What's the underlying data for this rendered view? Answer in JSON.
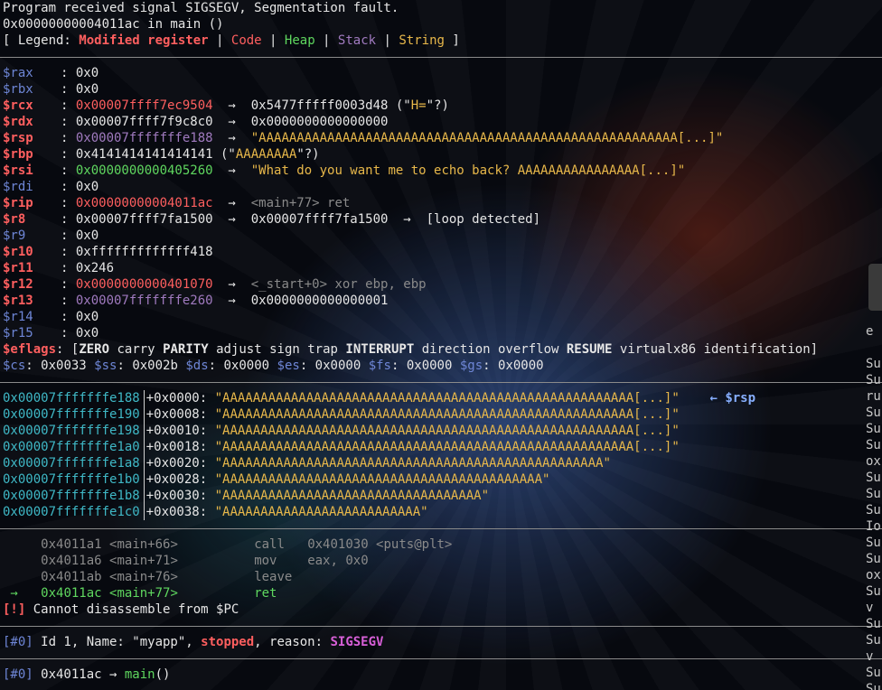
{
  "header": {
    "signal": "Program received signal SIGSEGV, Segmentation fault.",
    "location": "0x00000000004011ac in main ()",
    "legend_open": "[ Legend: ",
    "legend_modified": "Modified register",
    "legend_code": "Code",
    "legend_heap": "Heap",
    "legend_stack": "Stack",
    "legend_string": "String",
    "legend_sep": " | ",
    "legend_close": " ]"
  },
  "registers": [
    {
      "name": "$rax",
      "modified": false,
      "parts": [
        {
          "t": "0x0",
          "c": ""
        }
      ]
    },
    {
      "name": "$rbx",
      "modified": false,
      "parts": [
        {
          "t": "0x0",
          "c": ""
        }
      ]
    },
    {
      "name": "$rcx",
      "modified": true,
      "parts": [
        {
          "t": "0x00007ffff7ec9504",
          "c": "red"
        },
        {
          "t": "  →  0x5477fffff0003d48 (\"",
          "c": ""
        },
        {
          "t": "H=",
          "c": "yellow"
        },
        {
          "t": "\"?)",
          "c": ""
        }
      ]
    },
    {
      "name": "$rdx",
      "modified": true,
      "parts": [
        {
          "t": "0x00007ffff7f9c8c0  →  0x0000000000000000",
          "c": ""
        }
      ]
    },
    {
      "name": "$rsp",
      "modified": true,
      "parts": [
        {
          "t": "0x00007fffffffe188",
          "c": "purple"
        },
        {
          "t": "  →  ",
          "c": ""
        },
        {
          "t": "\"AAAAAAAAAAAAAAAAAAAAAAAAAAAAAAAAAAAAAAAAAAAAAAAAAAAAAAA[...]\"",
          "c": "yellow"
        }
      ]
    },
    {
      "name": "$rbp",
      "modified": true,
      "parts": [
        {
          "t": "0x4141414141414141 (\"",
          "c": ""
        },
        {
          "t": "AAAAAAAA",
          "c": "yellow"
        },
        {
          "t": "\"?)",
          "c": ""
        }
      ]
    },
    {
      "name": "$rsi",
      "modified": true,
      "parts": [
        {
          "t": "0x0000000000405260",
          "c": "green"
        },
        {
          "t": "  →  ",
          "c": ""
        },
        {
          "t": "\"What do you want me to echo back? AAAAAAAAAAAAAAAA[...]\"",
          "c": "yellow"
        }
      ]
    },
    {
      "name": "$rdi",
      "modified": false,
      "parts": [
        {
          "t": "0x0",
          "c": ""
        }
      ]
    },
    {
      "name": "$rip",
      "modified": true,
      "parts": [
        {
          "t": "0x00000000004011ac",
          "c": "red"
        },
        {
          "t": "  →  ",
          "c": ""
        },
        {
          "t": "<main+77> ret",
          "c": "gray"
        }
      ]
    },
    {
      "name": "$r8",
      "modified": true,
      "parts": [
        {
          "t": "0x00007ffff7fa1500  →  0x00007ffff7fa1500  →  [loop detected]",
          "c": ""
        }
      ]
    },
    {
      "name": "$r9",
      "modified": false,
      "parts": [
        {
          "t": "0x0",
          "c": ""
        }
      ]
    },
    {
      "name": "$r10",
      "modified": true,
      "parts": [
        {
          "t": "0xfffffffffffff418",
          "c": ""
        }
      ]
    },
    {
      "name": "$r11",
      "modified": true,
      "parts": [
        {
          "t": "0x246",
          "c": ""
        }
      ]
    },
    {
      "name": "$r12",
      "modified": true,
      "parts": [
        {
          "t": "0x0000000000401070",
          "c": "red"
        },
        {
          "t": "  →  ",
          "c": ""
        },
        {
          "t": "<_start+0> xor ebp, ebp",
          "c": "gray"
        }
      ]
    },
    {
      "name": "$r13",
      "modified": true,
      "parts": [
        {
          "t": "0x00007fffffffe260",
          "c": "purple"
        },
        {
          "t": "  →  0x0000000000000001",
          "c": ""
        }
      ]
    },
    {
      "name": "$r14",
      "modified": false,
      "parts": [
        {
          "t": "0x0",
          "c": ""
        }
      ]
    },
    {
      "name": "$r15",
      "modified": false,
      "parts": [
        {
          "t": "0x0",
          "c": ""
        }
      ]
    }
  ],
  "eflags": {
    "label": "$eflags",
    "open": "[",
    "flags": [
      {
        "t": "ZERO",
        "b": true
      },
      {
        "t": "carry",
        "b": false
      },
      {
        "t": "PARITY",
        "b": true
      },
      {
        "t": "adjust",
        "b": false
      },
      {
        "t": "sign",
        "b": false
      },
      {
        "t": "trap",
        "b": false
      },
      {
        "t": "INTERRUPT",
        "b": true
      },
      {
        "t": "direction",
        "b": false
      },
      {
        "t": "overflow",
        "b": false
      },
      {
        "t": "RESUME",
        "b": true
      },
      {
        "t": "virtualx86",
        "b": false
      },
      {
        "t": "identification",
        "b": false
      }
    ],
    "close": "]"
  },
  "segments": [
    {
      "name": "$cs",
      "value": "0x0033"
    },
    {
      "name": "$ss",
      "value": "0x002b"
    },
    {
      "name": "$ds",
      "value": "0x0000"
    },
    {
      "name": "$es",
      "value": "0x0000"
    },
    {
      "name": "$fs",
      "value": "0x0000"
    },
    {
      "name": "$gs",
      "value": "0x0000"
    }
  ],
  "stack": [
    {
      "addr": "0x00007fffffffe188",
      "off": "+0x0000",
      "val": "\"AAAAAAAAAAAAAAAAAAAAAAAAAAAAAAAAAAAAAAAAAAAAAAAAAAAAAA[...]\"",
      "note": "← $rsp"
    },
    {
      "addr": "0x00007fffffffe190",
      "off": "+0x0008",
      "val": "\"AAAAAAAAAAAAAAAAAAAAAAAAAAAAAAAAAAAAAAAAAAAAAAAAAAAAAA[...]\"",
      "note": ""
    },
    {
      "addr": "0x00007fffffffe198",
      "off": "+0x0010",
      "val": "\"AAAAAAAAAAAAAAAAAAAAAAAAAAAAAAAAAAAAAAAAAAAAAAAAAAAAAA[...]\"",
      "note": ""
    },
    {
      "addr": "0x00007fffffffe1a0",
      "off": "+0x0018",
      "val": "\"AAAAAAAAAAAAAAAAAAAAAAAAAAAAAAAAAAAAAAAAAAAAAAAAAAAAAA[...]\"",
      "note": ""
    },
    {
      "addr": "0x00007fffffffe1a8",
      "off": "+0x0020",
      "val": "\"AAAAAAAAAAAAAAAAAAAAAAAAAAAAAAAAAAAAAAAAAAAAAAAAAA\"",
      "note": ""
    },
    {
      "addr": "0x00007fffffffe1b0",
      "off": "+0x0028",
      "val": "\"AAAAAAAAAAAAAAAAAAAAAAAAAAAAAAAAAAAAAAAAAA\"",
      "note": ""
    },
    {
      "addr": "0x00007fffffffe1b8",
      "off": "+0x0030",
      "val": "\"AAAAAAAAAAAAAAAAAAAAAAAAAAAAAAAAAA\"",
      "note": ""
    },
    {
      "addr": "0x00007fffffffe1c0",
      "off": "+0x0038",
      "val": "\"AAAAAAAAAAAAAAAAAAAAAAAAAA\"",
      "note": ""
    }
  ],
  "code": [
    {
      "arrow": "  ",
      "addr": "0x4011a1",
      "sym": "<main+66>",
      "mn": "call",
      "ops": "0x401030 <puts@plt>",
      "current": false
    },
    {
      "arrow": "  ",
      "addr": "0x4011a6",
      "sym": "<main+71>",
      "mn": "mov",
      "ops": "eax, 0x0",
      "current": false
    },
    {
      "arrow": "  ",
      "addr": "0x4011ab",
      "sym": "<main+76>",
      "mn": "leave",
      "ops": "",
      "current": false
    },
    {
      "arrow": " →",
      "addr": "0x4011ac",
      "sym": "<main+77>",
      "mn": "ret",
      "ops": "",
      "current": true
    }
  ],
  "code_error": {
    "tag": "[!]",
    "text": " Cannot disassemble from $PC"
  },
  "threads": {
    "idx": "[#0]",
    "pre": " Id 1, Name: \"myapp\", ",
    "state": "stopped",
    "mid": ", reason: ",
    "reason": "SIGSEGV"
  },
  "trace": {
    "idx": "[#0]",
    "pre": " 0x4011ac → ",
    "func": "main",
    "post": "()"
  },
  "side_panel_lines": [
    "",
    "e",
    "",
    "Su",
    "Su",
    "ru",
    "Su",
    "Su",
    "Su",
    "ox",
    "Su",
    "Su",
    "Su",
    "Io",
    "Su",
    "Su",
    "ox",
    "Su",
    "v",
    "Su",
    "Su",
    "v",
    "Su",
    "Su"
  ]
}
